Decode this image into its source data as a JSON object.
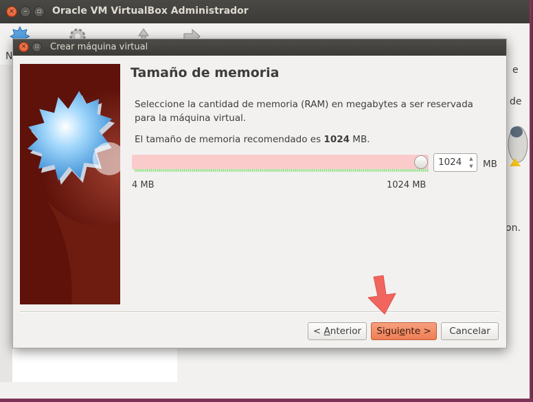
{
  "main_window": {
    "title": "Oracle VM VirtualBox Administrador",
    "toolbar_peek_letter": "N",
    "right_peek_text": [
      "e",
      "de",
      "on."
    ]
  },
  "dialog": {
    "title": "Crear máquina virtual",
    "page_title": "Tamaño de memoria",
    "description": "Seleccione la cantidad de memoria (RAM) en megabytes a ser reservada para la máquina virtual.",
    "recommended_prefix": "El tamaño de memoria recomendado es ",
    "recommended_value": "1024",
    "recommended_suffix": " MB.",
    "memory": {
      "value": "1024",
      "unit": "MB",
      "min_label": "4 MB",
      "max_label": "1024 MB",
      "slider_fraction": 1.0
    },
    "buttons": {
      "back_mnemonic_prefix": "< ",
      "back_mnemonic": "A",
      "back_rest": "nterior",
      "next_prefix": "Sigui",
      "next_mnemonic": "e",
      "next_rest": "nte >",
      "cancel": "Cancelar"
    }
  },
  "colors": {
    "accent": "#ee7e54",
    "slider_red": "#fbcbcb",
    "slider_green": "#98d98e",
    "titlebar": "#3c3b37",
    "arrow": "#f0655e"
  },
  "icons": [
    "close-icon",
    "minimize-icon",
    "new-vm-icon",
    "settings-icon",
    "discard-icon",
    "start-icon",
    "spin-up-icon",
    "spin-down-icon",
    "pointer-arrow-icon"
  ]
}
